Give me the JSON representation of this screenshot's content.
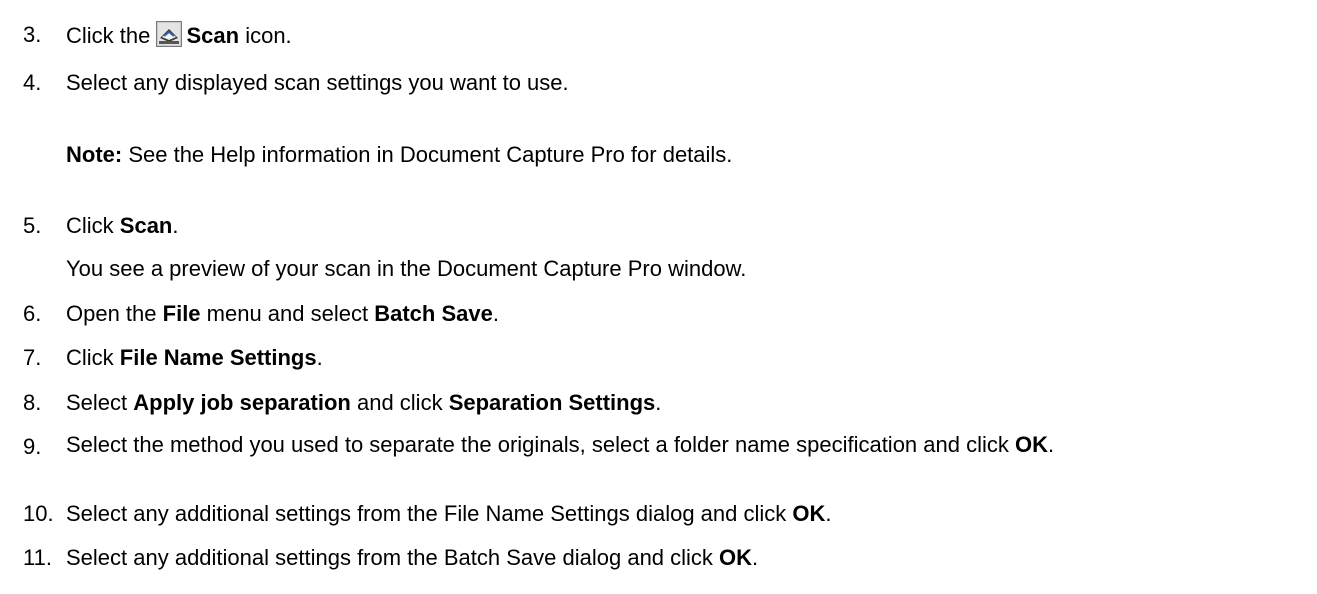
{
  "steps": [
    {
      "number": "3.",
      "parts": [
        "Click the ",
        "Scan",
        " icon."
      ]
    },
    {
      "number": "4.",
      "text": "Select any displayed scan settings you want to use."
    },
    {
      "note_label": "Note:",
      "note_text": " See the Help information in Document Capture Pro for details."
    },
    {
      "number": "5.",
      "parts": [
        "Click ",
        "Scan",
        "."
      ],
      "followup": "You see a preview of your scan in the Document Capture Pro window."
    },
    {
      "number": "6.",
      "parts": [
        "Open the ",
        "File",
        " menu and select ",
        "Batch Save",
        "."
      ]
    },
    {
      "number": "7.",
      "parts": [
        "Click ",
        "File Name Settings",
        "."
      ]
    },
    {
      "number": "8.",
      "parts": [
        "Select ",
        "Apply job separation",
        " and click ",
        "Separation Settings",
        "."
      ]
    },
    {
      "number": "9.",
      "parts": [
        "Select the method you used to separate the originals, select a folder name specification and click ",
        "OK",
        "."
      ]
    },
    {
      "number": "10.",
      "parts": [
        "Select any additional settings from the File Name Settings dialog and click ",
        "OK",
        "."
      ]
    },
    {
      "number": "11.",
      "parts": [
        "Select any additional settings from the Batch Save dialog and click ",
        "OK",
        "."
      ]
    }
  ],
  "icons": {
    "scan_icon": "scan-icon"
  }
}
